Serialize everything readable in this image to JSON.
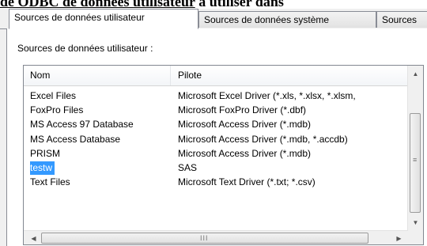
{
  "document_fragment": {
    "part1": "de ODBC",
    "part2": " de données ",
    "part3": "utilisateur",
    "part4": " à utiliser dans"
  },
  "tabs": [
    {
      "label": "Sources de données utilisateur",
      "active": true
    },
    {
      "label": "Sources de données système",
      "active": false
    },
    {
      "label": "Sources",
      "active": false
    }
  ],
  "section_label": "Sources de données utilisateur :",
  "columns": [
    "Nom",
    "Pilote"
  ],
  "rows": [
    {
      "name": "Excel Files",
      "driver": "Microsoft Excel Driver (*.xls, *.xlsx, *.xlsm,"
    },
    {
      "name": "FoxPro Files",
      "driver": "Microsoft FoxPro Driver (*.dbf)"
    },
    {
      "name": "MS Access 97 Database",
      "driver": "Microsoft Access Driver (*.mdb)"
    },
    {
      "name": "MS Access Database",
      "driver": "Microsoft Access Driver (*.mdb, *.accdb)"
    },
    {
      "name": "PRISM",
      "driver": "Microsoft Access Driver (*.mdb)"
    },
    {
      "name": "testw",
      "driver": "SAS",
      "selected": true
    },
    {
      "name": "Text Files",
      "driver": "Microsoft Text Driver (*.txt; *.csv)"
    }
  ],
  "icons": {
    "scroll_up": "▲",
    "scroll_down": "▼",
    "scroll_left": "◀",
    "scroll_right": "▶",
    "vgrip": "≡",
    "hgrip": "III"
  },
  "colors": {
    "selection": "#3399ff",
    "tab_border": "#898c95"
  }
}
